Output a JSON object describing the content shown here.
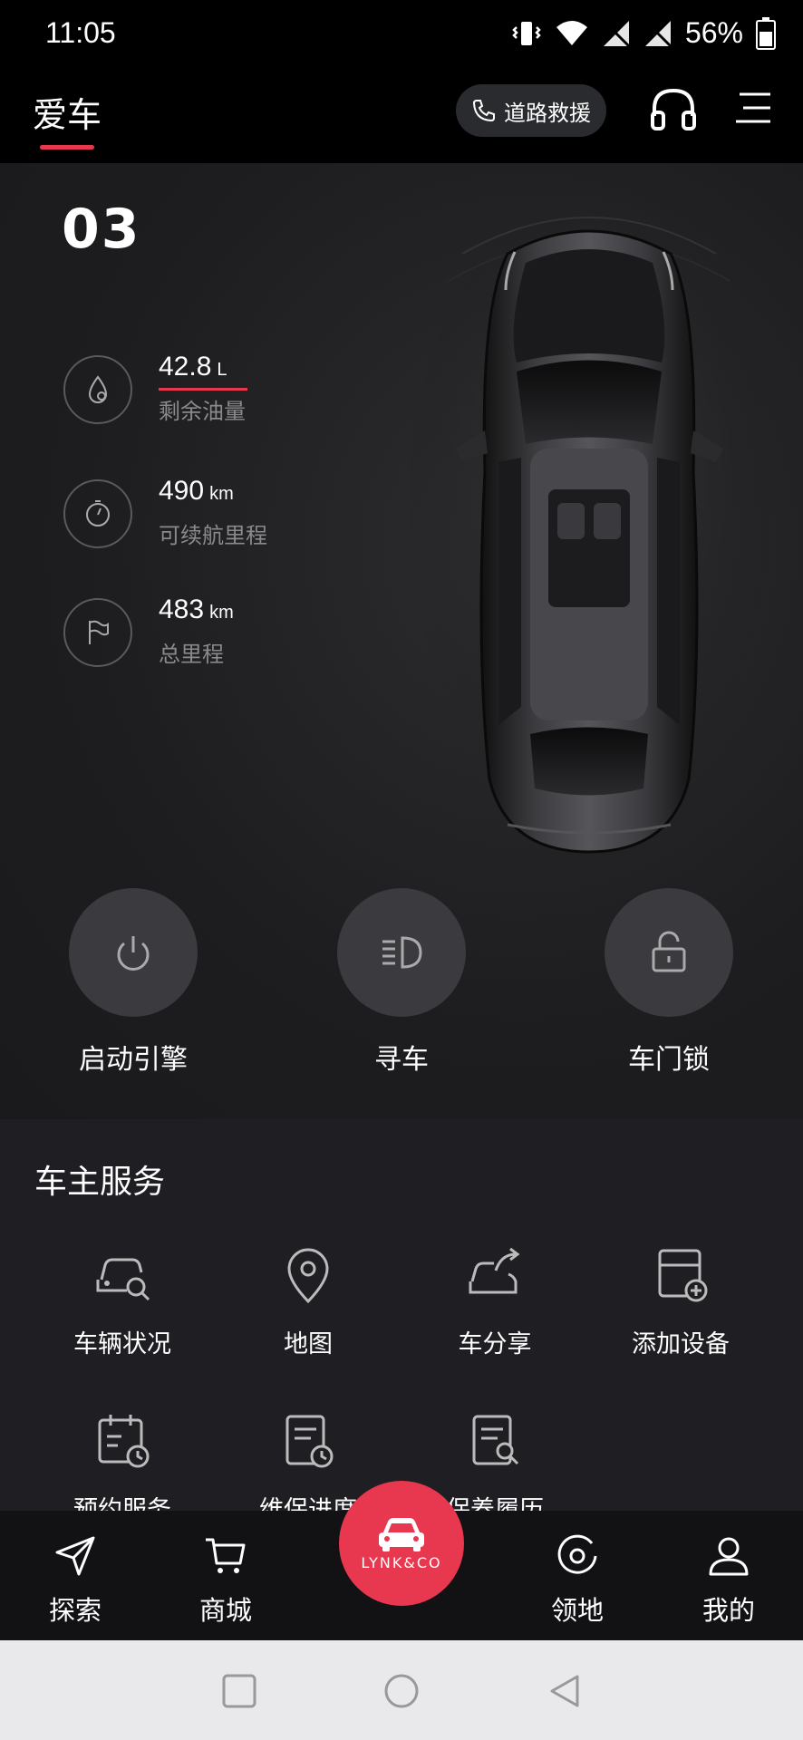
{
  "status_bar": {
    "time": "11:05",
    "battery": "56%"
  },
  "header": {
    "title": "爱车",
    "rescue_label": "道路救援"
  },
  "vehicle": {
    "model": "03",
    "stats": [
      {
        "value": "42.8",
        "unit": "L",
        "label": "剩余油量"
      },
      {
        "value": "490",
        "unit": "km",
        "label": "可续航里程"
      },
      {
        "value": "483",
        "unit": "km",
        "label": "总里程"
      }
    ],
    "actions": [
      {
        "label": "启动引擎"
      },
      {
        "label": "寻车"
      },
      {
        "label": "车门锁"
      }
    ]
  },
  "services": {
    "title": "车主服务",
    "items": [
      {
        "label": "车辆状况",
        "icon": "car-search-icon"
      },
      {
        "label": "地图",
        "icon": "map-pin-icon"
      },
      {
        "label": "车分享",
        "icon": "car-share-icon"
      },
      {
        "label": "添加设备",
        "icon": "add-device-icon"
      },
      {
        "label": "预约服务",
        "icon": "calendar-clock-icon"
      },
      {
        "label": "维保进度",
        "icon": "document-clock-icon"
      },
      {
        "label": "保养履历",
        "icon": "document-wrench-icon"
      }
    ]
  },
  "bottom_nav": {
    "items": [
      {
        "label": "探索"
      },
      {
        "label": "商城"
      },
      {
        "label": "领地"
      },
      {
        "label": "我的"
      }
    ],
    "brand": "LYNK&CO"
  },
  "colors": {
    "accent": "#e8384f",
    "panel": "#1d1d1f",
    "button": "#3a3a3f"
  }
}
